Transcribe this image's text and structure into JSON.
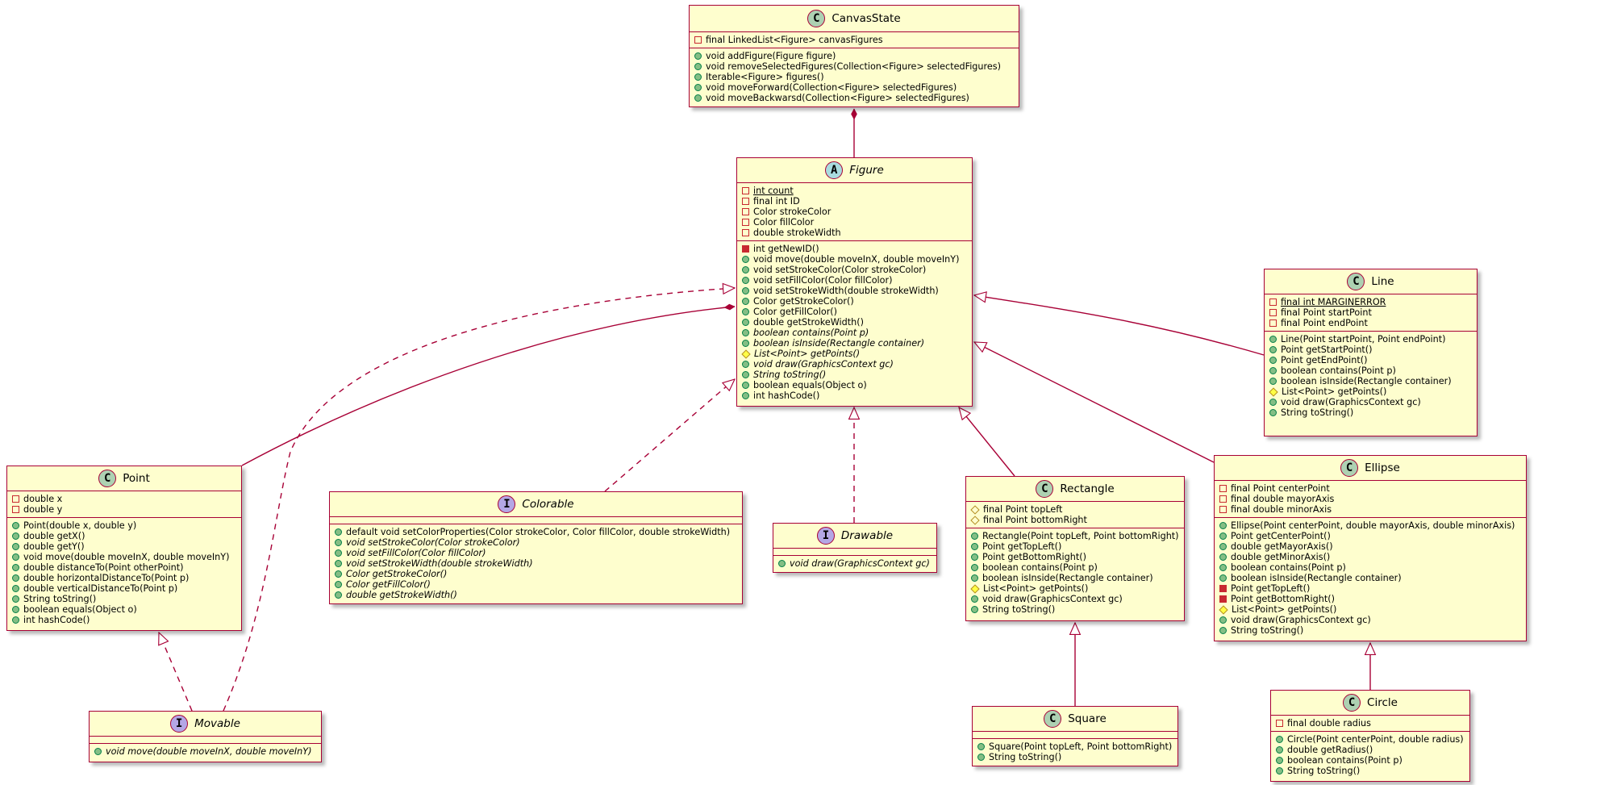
{
  "colors": {
    "class_fill": "#fefece",
    "border": "#a80036",
    "class_badge": "#add1b2",
    "abstract_badge": "#a9dcdf",
    "interface_badge": "#b4a7e5",
    "public": "#84be84",
    "private": "#c82930",
    "protected": "#ffff44"
  },
  "classes": {
    "canvasstate": {
      "kind": "class",
      "badge": "C",
      "name": "CanvasState",
      "fields": [
        {
          "vis": "private",
          "text": "final LinkedList<Figure> canvasFigures"
        }
      ],
      "methods": [
        {
          "vis": "public",
          "text": "void addFigure(Figure figure)"
        },
        {
          "vis": "public",
          "text": "void removeSelectedFigures(Collection<Figure> selectedFigures)"
        },
        {
          "vis": "public",
          "text": "Iterable<Figure> figures()"
        },
        {
          "vis": "public",
          "text": "void moveForward(Collection<Figure> selectedFigures)"
        },
        {
          "vis": "public",
          "text": "void moveBackwarsd(Collection<Figure> selectedFigures)"
        }
      ]
    },
    "figure": {
      "kind": "abstract",
      "badge": "A",
      "name": "Figure",
      "fields": [
        {
          "vis": "private",
          "text": "int count",
          "static": true
        },
        {
          "vis": "private",
          "text": "final int ID"
        },
        {
          "vis": "private",
          "text": "Color strokeColor"
        },
        {
          "vis": "private",
          "text": "Color fillColor"
        },
        {
          "vis": "private",
          "text": "double strokeWidth"
        }
      ],
      "methods": [
        {
          "vis": "private",
          "text": "int getNewID()"
        },
        {
          "vis": "public",
          "text": "void move(double moveInX, double moveInY)"
        },
        {
          "vis": "public",
          "text": "void setStrokeColor(Color strokeColor)"
        },
        {
          "vis": "public",
          "text": "void setFillColor(Color fillColor)"
        },
        {
          "vis": "public",
          "text": "void setStrokeWidth(double strokeWidth)"
        },
        {
          "vis": "public",
          "text": "Color getStrokeColor()"
        },
        {
          "vis": "public",
          "text": "Color getFillColor()"
        },
        {
          "vis": "public",
          "text": "double getStrokeWidth()"
        },
        {
          "vis": "public",
          "text": "boolean contains(Point p)",
          "italic": true
        },
        {
          "vis": "public",
          "text": "boolean isInside(Rectangle container)",
          "italic": true
        },
        {
          "vis": "protected",
          "text": "List<Point> getPoints()",
          "italic": true
        },
        {
          "vis": "public",
          "text": "void draw(GraphicsContext gc)",
          "italic": true
        },
        {
          "vis": "public",
          "text": "String toString()",
          "italic": true
        },
        {
          "vis": "public",
          "text": "boolean equals(Object o)"
        },
        {
          "vis": "public",
          "text": "int hashCode()"
        }
      ]
    },
    "line": {
      "kind": "class",
      "badge": "C",
      "name": "Line",
      "fields": [
        {
          "vis": "private",
          "text": "final int MARGINERROR",
          "static": true
        },
        {
          "vis": "private",
          "text": "final Point startPoint"
        },
        {
          "vis": "private",
          "text": "final Point endPoint"
        }
      ],
      "methods": [
        {
          "vis": "public",
          "text": "Line(Point startPoint, Point endPoint)"
        },
        {
          "vis": "public",
          "text": "Point getStartPoint()"
        },
        {
          "vis": "public",
          "text": "Point getEndPoint()"
        },
        {
          "vis": "public",
          "text": "boolean contains(Point p)"
        },
        {
          "vis": "public",
          "text": "boolean isInside(Rectangle container)"
        },
        {
          "vis": "protected",
          "text": "List<Point> getPoints()"
        },
        {
          "vis": "public",
          "text": "void draw(GraphicsContext gc)"
        },
        {
          "vis": "public",
          "text": "String toString()"
        }
      ]
    },
    "point": {
      "kind": "class",
      "badge": "C",
      "name": "Point",
      "fields": [
        {
          "vis": "private",
          "text": "double x"
        },
        {
          "vis": "private",
          "text": "double y"
        }
      ],
      "methods": [
        {
          "vis": "public",
          "text": "Point(double x, double y)"
        },
        {
          "vis": "public",
          "text": "double getX()"
        },
        {
          "vis": "public",
          "text": "double getY()"
        },
        {
          "vis": "public",
          "text": "void move(double moveInX, double moveInY)"
        },
        {
          "vis": "public",
          "text": "double distanceTo(Point otherPoint)"
        },
        {
          "vis": "public",
          "text": "double horizontalDistanceTo(Point p)"
        },
        {
          "vis": "public",
          "text": "double verticalDistanceTo(Point p)"
        },
        {
          "vis": "public",
          "text": "String toString()"
        },
        {
          "vis": "public",
          "text": "boolean equals(Object o)"
        },
        {
          "vis": "public",
          "text": "int hashCode()"
        }
      ]
    },
    "colorable": {
      "kind": "interface",
      "badge": "I",
      "name": "Colorable",
      "fields": [],
      "methods": [
        {
          "vis": "public",
          "text": "default void setColorProperties(Color strokeColor, Color fillColor, double strokeWidth)"
        },
        {
          "vis": "public",
          "text": "void setStrokeColor(Color strokeColor)",
          "italic": true
        },
        {
          "vis": "public",
          "text": "void setFillColor(Color fillColor)",
          "italic": true
        },
        {
          "vis": "public",
          "text": "void setStrokeWidth(double strokeWidth)",
          "italic": true
        },
        {
          "vis": "public",
          "text": "Color getStrokeColor()",
          "italic": true
        },
        {
          "vis": "public",
          "text": "Color getFillColor()",
          "italic": true
        },
        {
          "vis": "public",
          "text": "double getStrokeWidth()",
          "italic": true
        }
      ]
    },
    "drawable": {
      "kind": "interface",
      "badge": "I",
      "name": "Drawable",
      "fields": [],
      "methods": [
        {
          "vis": "public",
          "text": "void draw(GraphicsContext gc)",
          "italic": true
        }
      ]
    },
    "rectangle": {
      "kind": "class",
      "badge": "C",
      "name": "Rectangle",
      "fields": [
        {
          "vis": "protected",
          "text": "final Point topLeft"
        },
        {
          "vis": "protected",
          "text": "final Point bottomRight"
        }
      ],
      "methods": [
        {
          "vis": "public",
          "text": "Rectangle(Point topLeft, Point bottomRight)"
        },
        {
          "vis": "public",
          "text": "Point getTopLeft()"
        },
        {
          "vis": "public",
          "text": "Point getBottomRight()"
        },
        {
          "vis": "public",
          "text": "boolean contains(Point p)"
        },
        {
          "vis": "public",
          "text": "boolean isInside(Rectangle container)"
        },
        {
          "vis": "protected",
          "text": "List<Point> getPoints()"
        },
        {
          "vis": "public",
          "text": "void draw(GraphicsContext gc)"
        },
        {
          "vis": "public",
          "text": "String toString()"
        }
      ]
    },
    "ellipse": {
      "kind": "class",
      "badge": "C",
      "name": "Ellipse",
      "fields": [
        {
          "vis": "private",
          "text": "final Point centerPoint"
        },
        {
          "vis": "private",
          "text": "final double mayorAxis"
        },
        {
          "vis": "private",
          "text": "final double minorAxis"
        }
      ],
      "methods": [
        {
          "vis": "public",
          "text": "Ellipse(Point centerPoint, double mayorAxis, double minorAxis)"
        },
        {
          "vis": "public",
          "text": "Point getCenterPoint()"
        },
        {
          "vis": "public",
          "text": "double getMayorAxis()"
        },
        {
          "vis": "public",
          "text": "double getMinorAxis()"
        },
        {
          "vis": "public",
          "text": "boolean contains(Point p)"
        },
        {
          "vis": "public",
          "text": "boolean isInside(Rectangle container)"
        },
        {
          "vis": "private",
          "text": "Point getTopLeft()"
        },
        {
          "vis": "private",
          "text": "Point getBottomRight()"
        },
        {
          "vis": "protected",
          "text": "List<Point> getPoints()"
        },
        {
          "vis": "public",
          "text": "void draw(GraphicsContext gc)"
        },
        {
          "vis": "public",
          "text": "String toString()"
        }
      ]
    },
    "movable": {
      "kind": "interface",
      "badge": "I",
      "name": "Movable",
      "fields": [],
      "methods": [
        {
          "vis": "public",
          "text": "void move(double moveInX, double moveInY)",
          "italic": true
        }
      ]
    },
    "square": {
      "kind": "class",
      "badge": "C",
      "name": "Square",
      "fields": [],
      "methods": [
        {
          "vis": "public",
          "text": "Square(Point topLeft, Point bottomRight)"
        },
        {
          "vis": "public",
          "text": "String toString()"
        }
      ]
    },
    "circle": {
      "kind": "class",
      "badge": "C",
      "name": "Circle",
      "fields": [
        {
          "vis": "private",
          "text": "final double radius"
        }
      ],
      "methods": [
        {
          "vis": "public",
          "text": "Circle(Point centerPoint, double radius)"
        },
        {
          "vis": "public",
          "text": "double getRadius()"
        },
        {
          "vis": "public",
          "text": "boolean contains(Point p)"
        },
        {
          "vis": "public",
          "text": "String toString()"
        }
      ]
    }
  },
  "relations": [
    {
      "from": "canvasstate",
      "to": "figure",
      "type": "composition"
    },
    {
      "from": "figure",
      "to": "point",
      "type": "composition"
    },
    {
      "from": "movable",
      "to": "figure",
      "type": "realization"
    },
    {
      "from": "colorable",
      "to": "figure",
      "type": "realization"
    },
    {
      "from": "drawable",
      "to": "figure",
      "type": "realization"
    },
    {
      "from": "line",
      "to": "figure",
      "type": "inheritance"
    },
    {
      "from": "rectangle",
      "to": "figure",
      "type": "inheritance"
    },
    {
      "from": "ellipse",
      "to": "figure",
      "type": "inheritance"
    },
    {
      "from": "square",
      "to": "rectangle",
      "type": "inheritance"
    },
    {
      "from": "circle",
      "to": "ellipse",
      "type": "inheritance"
    },
    {
      "from": "movable",
      "to": "point",
      "type": "realization"
    }
  ]
}
